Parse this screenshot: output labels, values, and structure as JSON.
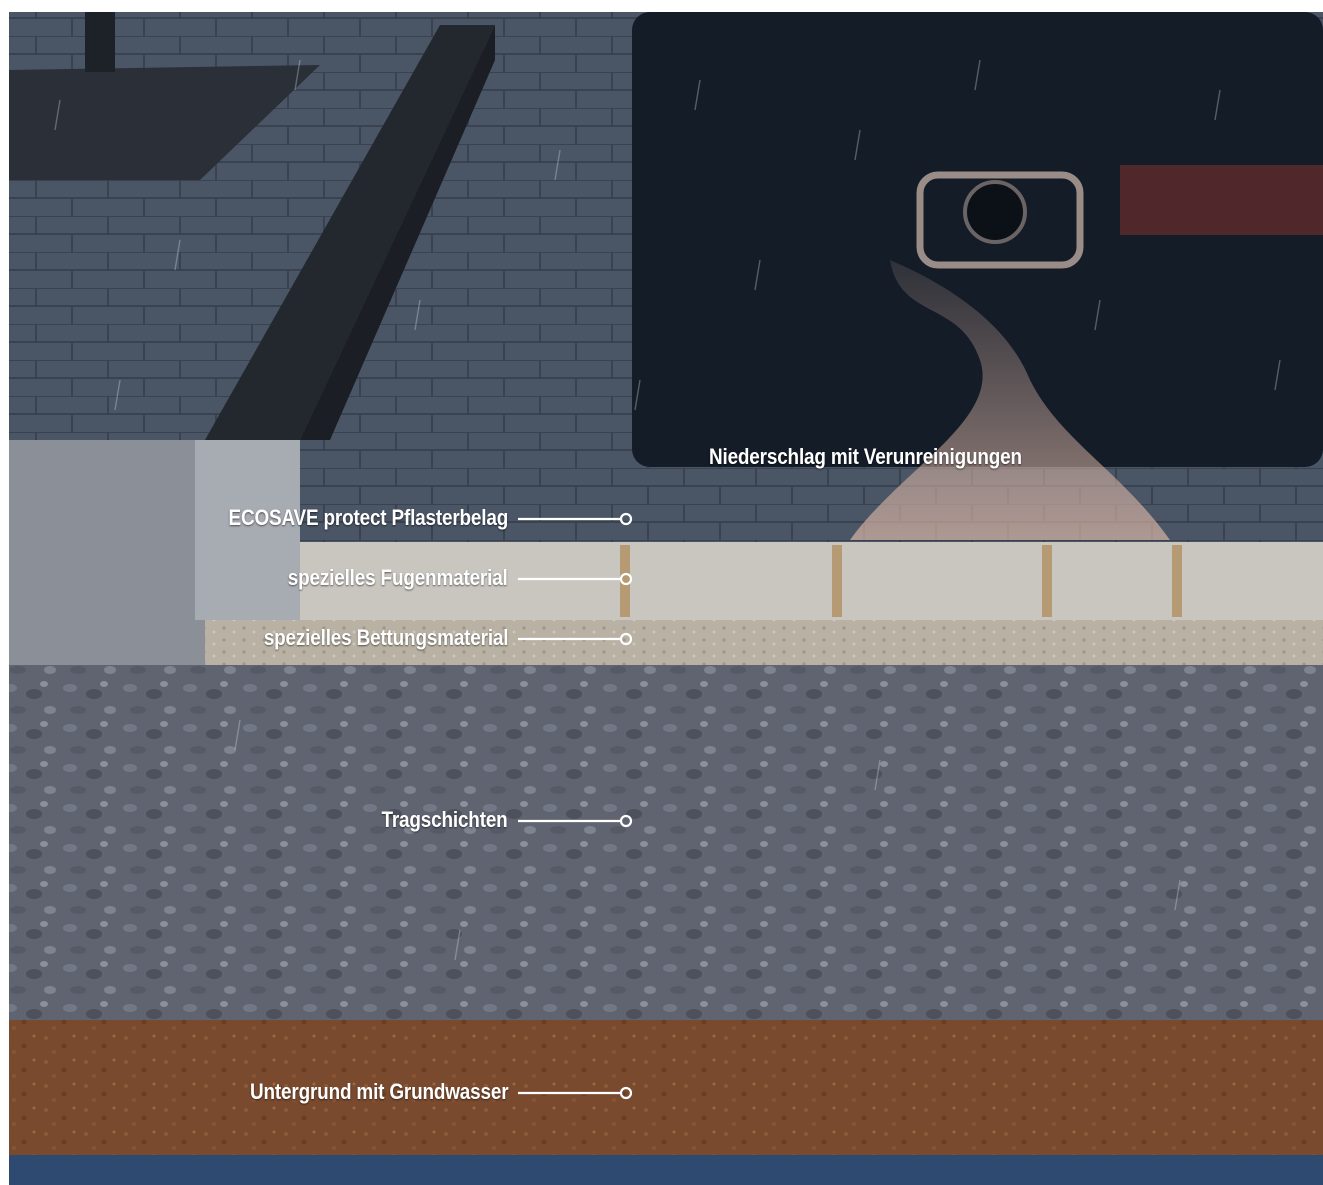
{
  "colors": {
    "paving_top": "#4a5566",
    "curb": "#23272e",
    "vehicle": "#141c28",
    "concrete_section": "#c9c6c0",
    "bedding": "#b9b2a4",
    "gravel": "#5f6470",
    "subsoil": "#7a4a2e",
    "groundwater": "#2f4a70",
    "label_text": "#ffffff"
  },
  "labels": {
    "precipitation": "Niederschlag mit Verunreinigungen",
    "paving": "ECOSAVE protect Pflasterbelag",
    "joint_material": "spezielles Fugenmaterial",
    "bedding_material": "spezielles Bettungsmaterial",
    "base_layers": "Tragschichten",
    "subsoil": "Untergrund mit Grundwasser"
  }
}
